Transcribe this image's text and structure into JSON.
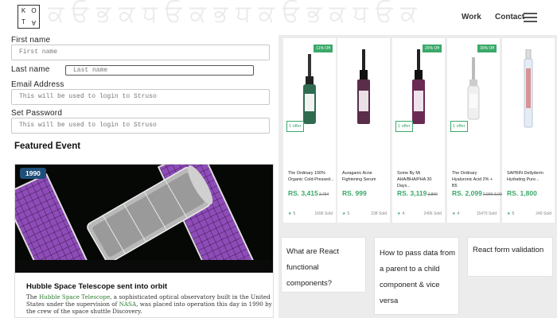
{
  "header": {
    "logo_letters": [
      "K",
      "O",
      "T",
      "A"
    ],
    "nav": [
      "Work",
      "Contact"
    ],
    "menu_icon": "hamburger-icon"
  },
  "form": {
    "fields": [
      {
        "label": "First name",
        "placeholder": "First name"
      },
      {
        "label": "Last name",
        "placeholder": "Last name"
      },
      {
        "label": "Email Address",
        "placeholder": "This will be used to login to Struso"
      },
      {
        "label": "Set Password",
        "placeholder": "This will be used to login to Struso"
      }
    ]
  },
  "featured": {
    "title": "Featured Event",
    "event": {
      "year": "1990",
      "heading": "Hubble Space Telescope sent into orbit",
      "text_pre": "The ",
      "link1": "Hubble Space Telescope",
      "text_mid": ", a sophisticated optical observatory built in the United States under the supervision of ",
      "link2": "NASA",
      "text_post": ", was placed into operation this day in 1990 by the crew of the space shuttle Discovery."
    }
  },
  "products": [
    {
      "name": "The Ordinary 100% Organic Cold-Pressed...",
      "price": "RS. 3,415",
      "old_price": "3,794",
      "discount": "11% Off",
      "offer": "1 offer",
      "rating": "5",
      "sold": "1696 Sold",
      "bottle_color": "#2f6b4f"
    },
    {
      "name": "Auraganic Acne Fightening Serum",
      "price": "RS. 999",
      "old_price": "",
      "discount": "",
      "offer": "",
      "rating": "5",
      "sold": "238 Sold",
      "bottle_color": "#5a2d4a"
    },
    {
      "name": "Some By Mi AHA/BHA/PHA 30 Days...",
      "price": "RS. 3,119",
      "old_price": "3,899",
      "discount": "20% Off",
      "offer": "1 offer",
      "rating": "4",
      "sold": "2496 Sold",
      "bottle_color": "#6b2a52"
    },
    {
      "name": "The Ordinary Hyaluronic Acid 2% + B5",
      "price": "RS. 2,099",
      "old_price": "2,999-3,000",
      "discount": "30% Off",
      "offer": "1 offer",
      "rating": "4",
      "sold": "15470 Sold",
      "bottle_color": "#d6d6d6"
    },
    {
      "name": "SAPRIN Dellyderm Hydrating Pure...",
      "price": "RS. 1,800",
      "old_price": "",
      "discount": "",
      "offer": "",
      "rating": "5",
      "sold": "249 Sold",
      "bottle_color": "#c9d6e8"
    }
  ],
  "questions": [
    "What are React functional components?",
    "How to pass data from a parent to a child component & vice versa",
    "React form validation"
  ],
  "colors": {
    "accent_green": "#3ba86a",
    "year_badge": "#1f4e79",
    "solar_panel": "#7a3ea0"
  }
}
